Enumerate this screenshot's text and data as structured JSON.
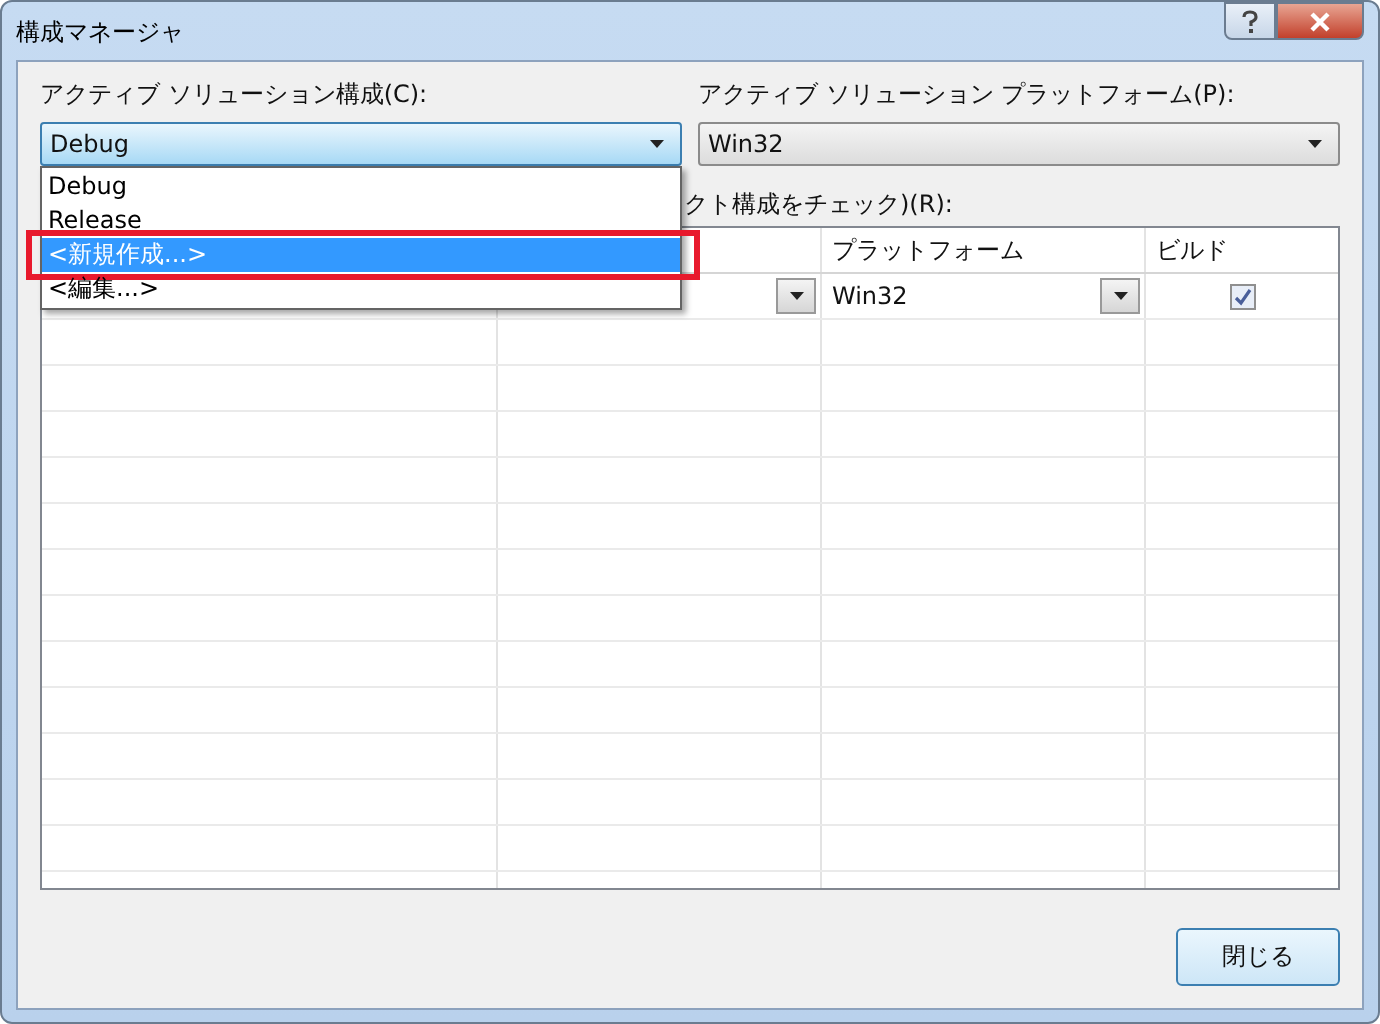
{
  "window": {
    "title": "構成マネージャ"
  },
  "active_config": {
    "label": "アクティブ ソリューション構成(C):",
    "value": "Debug",
    "options": [
      {
        "label": "Debug",
        "highlighted": false
      },
      {
        "label": "Release",
        "highlighted": false
      },
      {
        "label": "<新規作成...>",
        "highlighted": true
      },
      {
        "label": "<編集...>",
        "highlighted": false
      }
    ]
  },
  "active_platform": {
    "label": "アクティブ ソリューション プラットフォーム(P):",
    "value": "Win32"
  },
  "project_contexts": {
    "label": "クト構成をチェック)(R):",
    "columns": [
      "プラットフォーム",
      "ビルド"
    ],
    "rows": [
      {
        "platform": "Win32",
        "build": true
      }
    ]
  },
  "close_button": "閉じる"
}
